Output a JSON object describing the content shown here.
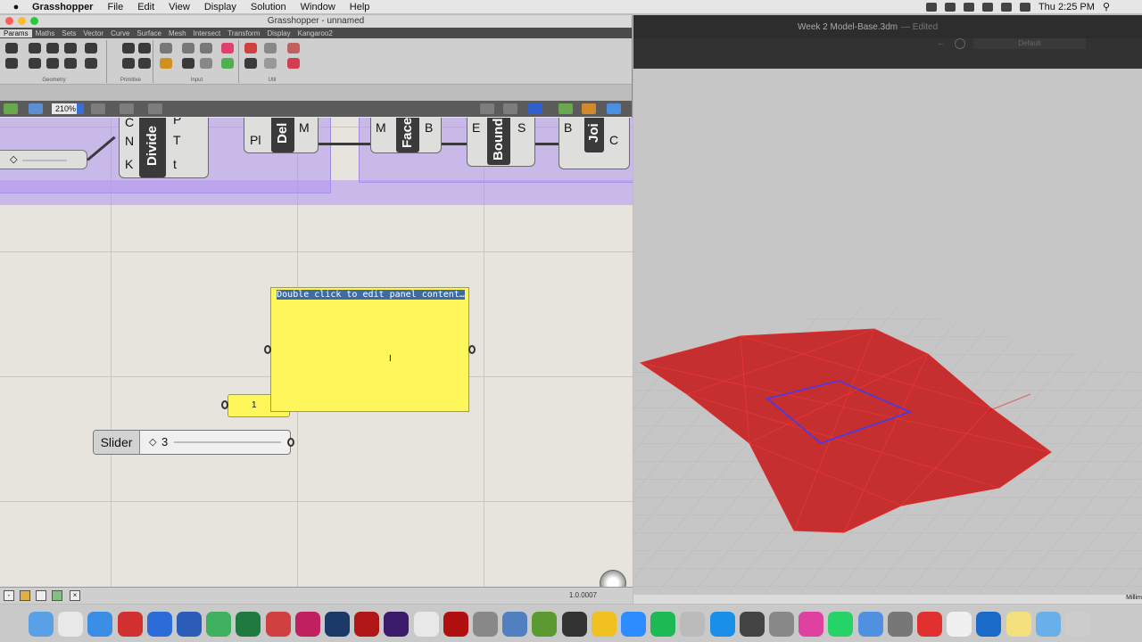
{
  "menubar": {
    "app_name": "Grasshopper",
    "items": [
      "File",
      "Edit",
      "View",
      "Display",
      "Solution",
      "Window",
      "Help"
    ],
    "clock": "Thu 2:25 PM"
  },
  "gh": {
    "window_title": "Grasshopper - unnamed",
    "tabs": [
      "Params",
      "Maths",
      "Sets",
      "Vector",
      "Curve",
      "Surface",
      "Mesh",
      "Intersect",
      "Transform",
      "Display",
      "Kangaroo2"
    ],
    "ribbon_groups": [
      "Geometry",
      "Primitive",
      "Input",
      "Util"
    ],
    "zoom": "210%",
    "components": {
      "divide": {
        "title": "Divide",
        "inputs": [
          "C",
          "N",
          "K"
        ],
        "outputs": [
          "P",
          "T",
          "t"
        ]
      },
      "delaunay": {
        "title": "Del",
        "inputs": [
          "Pl"
        ],
        "outputs": [
          "M"
        ]
      },
      "faces": {
        "title": "Face",
        "inputs": [
          "M"
        ],
        "outputs": [
          "B"
        ]
      },
      "boundary": {
        "title": "Bound",
        "inputs": [
          "E"
        ],
        "outputs": [
          "S"
        ]
      },
      "join": {
        "title": "Joi",
        "inputs": [
          "B"
        ],
        "outputs": [
          "C"
        ]
      }
    },
    "panel_text": "Double click to edit panel content…",
    "number_panel": "1",
    "slider": {
      "label": "Slider",
      "value": "3"
    },
    "version": "1.0.0007"
  },
  "rhino": {
    "doc_title": "Week 2 Model-Base.3dm",
    "doc_state": "— Edited",
    "layer_field": "Default",
    "status_right": "Millim"
  },
  "colors": {
    "mesh_red": "#c41414",
    "panel_yellow": "#fdf75c",
    "group_purple": "#b096f0",
    "highlight_blue": "#3f6ba3"
  },
  "dock_icons": [
    "finder-icon",
    "chrome-icon",
    "safari-icon",
    "zotero-icon",
    "word-icon",
    "word-icon-2",
    "grammarly-icon",
    "excel-icon",
    "acrobat-icon",
    "indesign-icon",
    "photoshop-icon",
    "acrobat-dc-icon",
    "premiere-icon",
    "rhino-icon",
    "autocad-icon",
    "grasshopper-icon",
    "r-icon",
    "qgis-icon",
    "notion-icon",
    "miro-icon",
    "zoom-icon",
    "spotify-icon",
    "archive-icon",
    "appstore-icon",
    "dashboard-icon",
    "settings-icon",
    "slack-icon",
    "whatsapp-icon",
    "qspace-icon",
    "mail-icon",
    "timer-icon",
    "pages-icon",
    "outlook-icon",
    "notes-icon",
    "folder-icon",
    "trash-icon"
  ]
}
